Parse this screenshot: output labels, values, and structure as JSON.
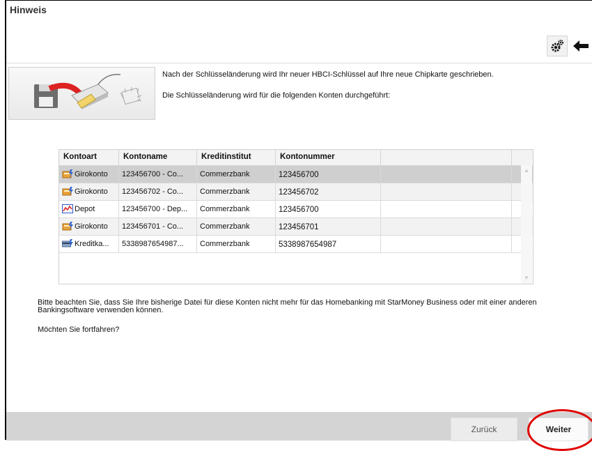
{
  "dialog": {
    "title": "Hinweis",
    "intro_line1": "Nach der Schlüsseländerung wird Ihr neuer HBCI-Schlüssel auf Ihre neue Chipkarte geschrieben.",
    "intro_line2": "Die Schlüsseländerung wird für die folgenden Konten durchgeführt:",
    "notice": "Bitte beachten Sie, dass Sie Ihre bisherige Datei für diese Konten nicht mehr für das Homebanking mit StarMoney Business oder mit einer anderen Bankingsoftware verwenden können.",
    "question": "Möchten Sie fortfahren?"
  },
  "toolbar": {
    "settings_icon": "gears-icon",
    "back_icon": "arrow-left-icon"
  },
  "table": {
    "columns": [
      "Kontoart",
      "Kontoname",
      "Kreditinstitut",
      "Kontonummer",
      ""
    ],
    "rows": [
      {
        "kontoart": "Girokonto",
        "kontoname": "123456700 - Co...",
        "kreditinstitut": "Commerzbank",
        "kontonummer": "123456700",
        "icon": "girokonto-icon"
      },
      {
        "kontoart": "Girokonto",
        "kontoname": "123456702 - Co...",
        "kreditinstitut": "Commerzbank",
        "kontonummer": "123456702",
        "icon": "girokonto-icon"
      },
      {
        "kontoart": "Depot",
        "kontoname": "123456700 - Dep...",
        "kreditinstitut": "Commerzbank",
        "kontonummer": "123456700",
        "icon": "depot-icon"
      },
      {
        "kontoart": "Girokonto",
        "kontoname": "123456701 - Co...",
        "kreditinstitut": "Commerzbank",
        "kontonummer": "123456701",
        "icon": "girokonto-icon"
      },
      {
        "kontoart": "Kreditka...",
        "kontoname": "5338987654987...",
        "kreditinstitut": "Commerzbank",
        "kontonummer": "5338987654987",
        "icon": "kreditkarte-icon"
      }
    ]
  },
  "footer": {
    "back_label": "Zurück",
    "next_label": "Weiter"
  },
  "colors": {
    "highlight": "#e00000",
    "selected_row": "#cfcfcf",
    "footer_bg": "#d4d4d4"
  }
}
